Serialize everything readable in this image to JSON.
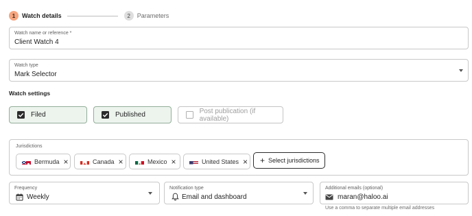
{
  "stepper": {
    "steps": [
      {
        "number": "1",
        "label": "Watch details",
        "state": "active"
      },
      {
        "number": "2",
        "label": "Parameters",
        "state": "inactive"
      }
    ]
  },
  "watch_name": {
    "label": "Watch name or reference *",
    "value": "Client Watch 4"
  },
  "watch_type": {
    "label": "Watch type",
    "value": "Mark Selector"
  },
  "settings": {
    "title": "Watch settings",
    "options": [
      {
        "label": "Filed",
        "checked": true
      },
      {
        "label": "Published",
        "checked": true
      },
      {
        "label": "Post publication (if available)",
        "checked": false
      }
    ]
  },
  "jurisdictions": {
    "label": "Jurisdictions",
    "chips": [
      {
        "label": "Bermuda",
        "flag": "bermuda-flag-icon"
      },
      {
        "label": "Canada",
        "flag": "canada-flag-icon"
      },
      {
        "label": "Mexico",
        "flag": "mexico-flag-icon"
      },
      {
        "label": "United States",
        "flag": "us-flag-icon"
      }
    ],
    "select_button": "Select jurisdictions"
  },
  "frequency": {
    "label": "Frequency",
    "value": "Weekly",
    "icon": "calendar-icon"
  },
  "notification": {
    "label": "Notification type",
    "value": "Email and dashboard",
    "icon": "bell-icon"
  },
  "emails": {
    "label": "Additional emails (optional)",
    "value": "maran@haloo.ai",
    "icon": "mail-icon",
    "helper": "Use a comma to separate multiple email addresses"
  },
  "colors": {
    "accent": "#f6a67f",
    "checked_bg": "#edf4ee",
    "checked_border": "#92ad98"
  }
}
